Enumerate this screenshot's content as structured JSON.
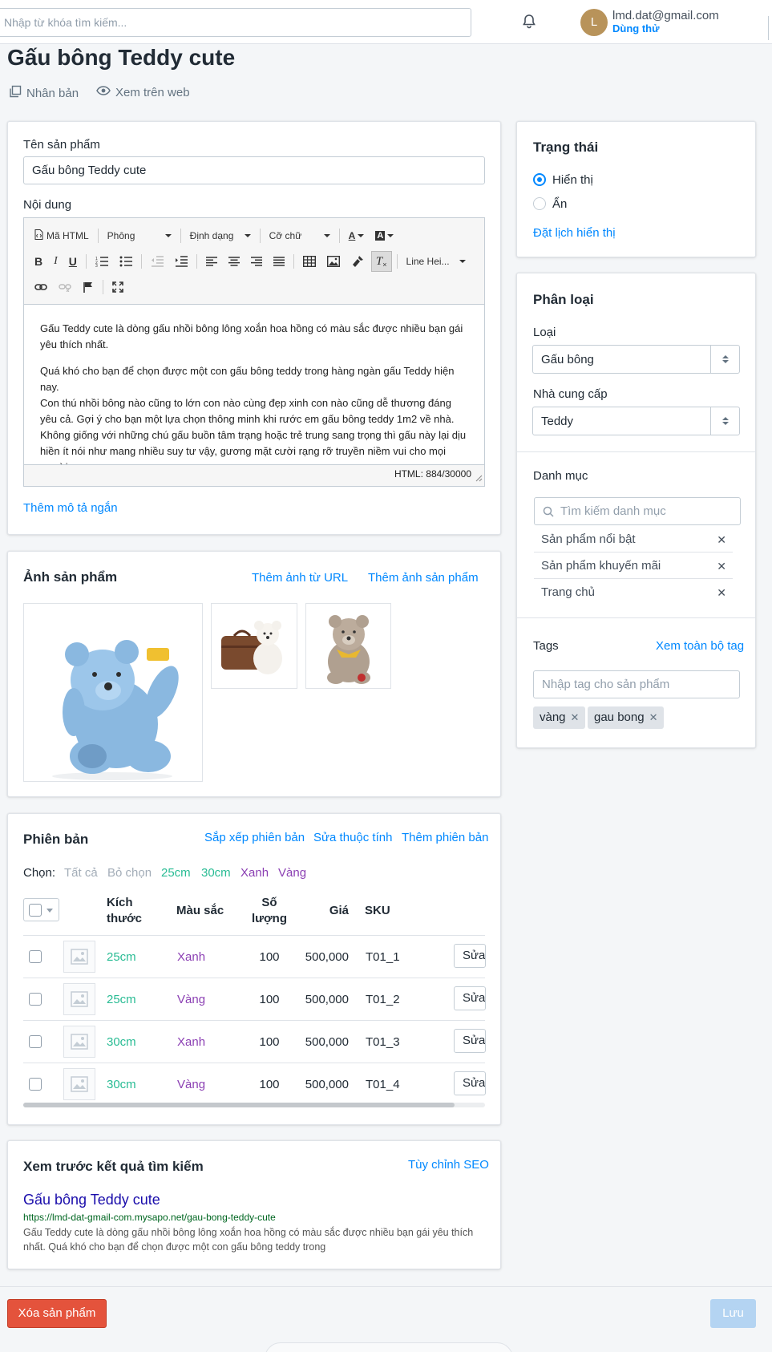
{
  "header": {
    "search_placeholder": "Nhập từ khóa tìm kiếm...",
    "avatar_initial": "L",
    "user_email": "lmd.dat@gmail.com",
    "user_plan": "Dùng thử"
  },
  "page": {
    "title": "Gấu bông Teddy cute",
    "actions": {
      "duplicate": "Nhân bản",
      "view_on_web": "Xem trên web"
    }
  },
  "product": {
    "name_label": "Tên sản phẩm",
    "name_value": "Gấu bông Teddy cute",
    "content_label": "Nội dung",
    "short_desc_link": "Thêm mô tả ngắn"
  },
  "editor": {
    "html_btn": "Mã HTML",
    "font": "Phông",
    "format": "Định dạng",
    "font_size": "Cỡ chữ",
    "line_height": "Line Hei...",
    "paragraphs": [
      "Gấu Teddy cute là dòng gấu nhồi bông lông xoắn hoa hồng có màu sắc được nhiều bạn gái yêu thích nhất.",
      "Quá khó cho bạn để chọn được một con gấu bông teddy trong hàng ngàn gấu Teddy hiện nay.",
      "Con thú nhồi bông nào cũng to lớn con nào cùng đẹp xinh con nào cũng dễ thương đáng yêu cả. Gợi ý cho bạn một lựa chọn thông minh khi rước em gấu bông teddy 1m2 về nhà. Không giống với những chú gấu buồn tâm trạng hoặc trẻ trung sang trọng thì gấu này lại dịu hiền ít nói như mang nhiều suy tư vậy, gương mặt cười rạng rỡ truyền niềm vui cho mọi người."
    ],
    "status": "HTML: 884/30000"
  },
  "images": {
    "title": "Ảnh sản phẩm",
    "add_url": "Thêm ảnh từ URL",
    "add_image": "Thêm ảnh sản phẩm"
  },
  "variants": {
    "title": "Phiên bản",
    "sort": "Sắp xếp phiên bản",
    "edit_attr": "Sửa thuộc tính",
    "add": "Thêm phiên bản",
    "choose_label": "Chọn:",
    "filters": [
      "Tất cả",
      "Bỏ chọn",
      "25cm",
      "30cm",
      "Xanh",
      "Vàng"
    ],
    "columns": [
      "Kích thước",
      "Màu sắc",
      "Số lượng",
      "Giá",
      "SKU"
    ],
    "edit_btn": "Sửa",
    "rows": [
      {
        "size": "25cm",
        "color": "Xanh",
        "qty": "100",
        "price": "500,000",
        "sku": "T01_1"
      },
      {
        "size": "25cm",
        "color": "Vàng",
        "qty": "100",
        "price": "500,000",
        "sku": "T01_2"
      },
      {
        "size": "30cm",
        "color": "Xanh",
        "qty": "100",
        "price": "500,000",
        "sku": "T01_3"
      },
      {
        "size": "30cm",
        "color": "Vàng",
        "qty": "100",
        "price": "500,000",
        "sku": "T01_4"
      }
    ]
  },
  "seo": {
    "title": "Xem trước kết quả tìm kiếm",
    "customize": "Tùy chỉnh SEO",
    "preview_title": "Gấu bông Teddy cute",
    "preview_url": "https://lmd-dat-gmail-com.mysapo.net/gau-bong-teddy-cute",
    "preview_desc": "Gấu Teddy cute là dòng gấu nhồi bông lông xoắn hoa hồng có màu sắc được nhiều bạn gái yêu thích nhất.  Quá khó cho bạn để chọn được một con gấu bông teddy trong"
  },
  "status": {
    "title": "Trạng thái",
    "visible": "Hiển thị",
    "hidden": "Ẩn",
    "schedule": "Đặt lịch hiển thị"
  },
  "classification": {
    "title": "Phân loại",
    "type_label": "Loại",
    "type_value": "Gấu bông",
    "vendor_label": "Nhà cung cấp",
    "vendor_value": "Teddy",
    "category_label": "Danh mục",
    "category_placeholder": "Tìm kiếm danh mục",
    "categories": [
      "Sản phẩm nổi bật",
      "Sản phẩm khuyến mãi",
      "Trang chủ"
    ],
    "tags_label": "Tags",
    "view_all_tags": "Xem toàn bộ tag",
    "tag_placeholder": "Nhập tag cho sản phẩm",
    "tags": [
      "vàng",
      "gau bong"
    ]
  },
  "footer": {
    "delete": "Xóa sản phẩm",
    "save": "Lưu"
  },
  "colors": {
    "accent": "#0088ff",
    "size_green": "#29bc94",
    "color_purple": "#8b3fb3",
    "danger": "#e4533c"
  }
}
